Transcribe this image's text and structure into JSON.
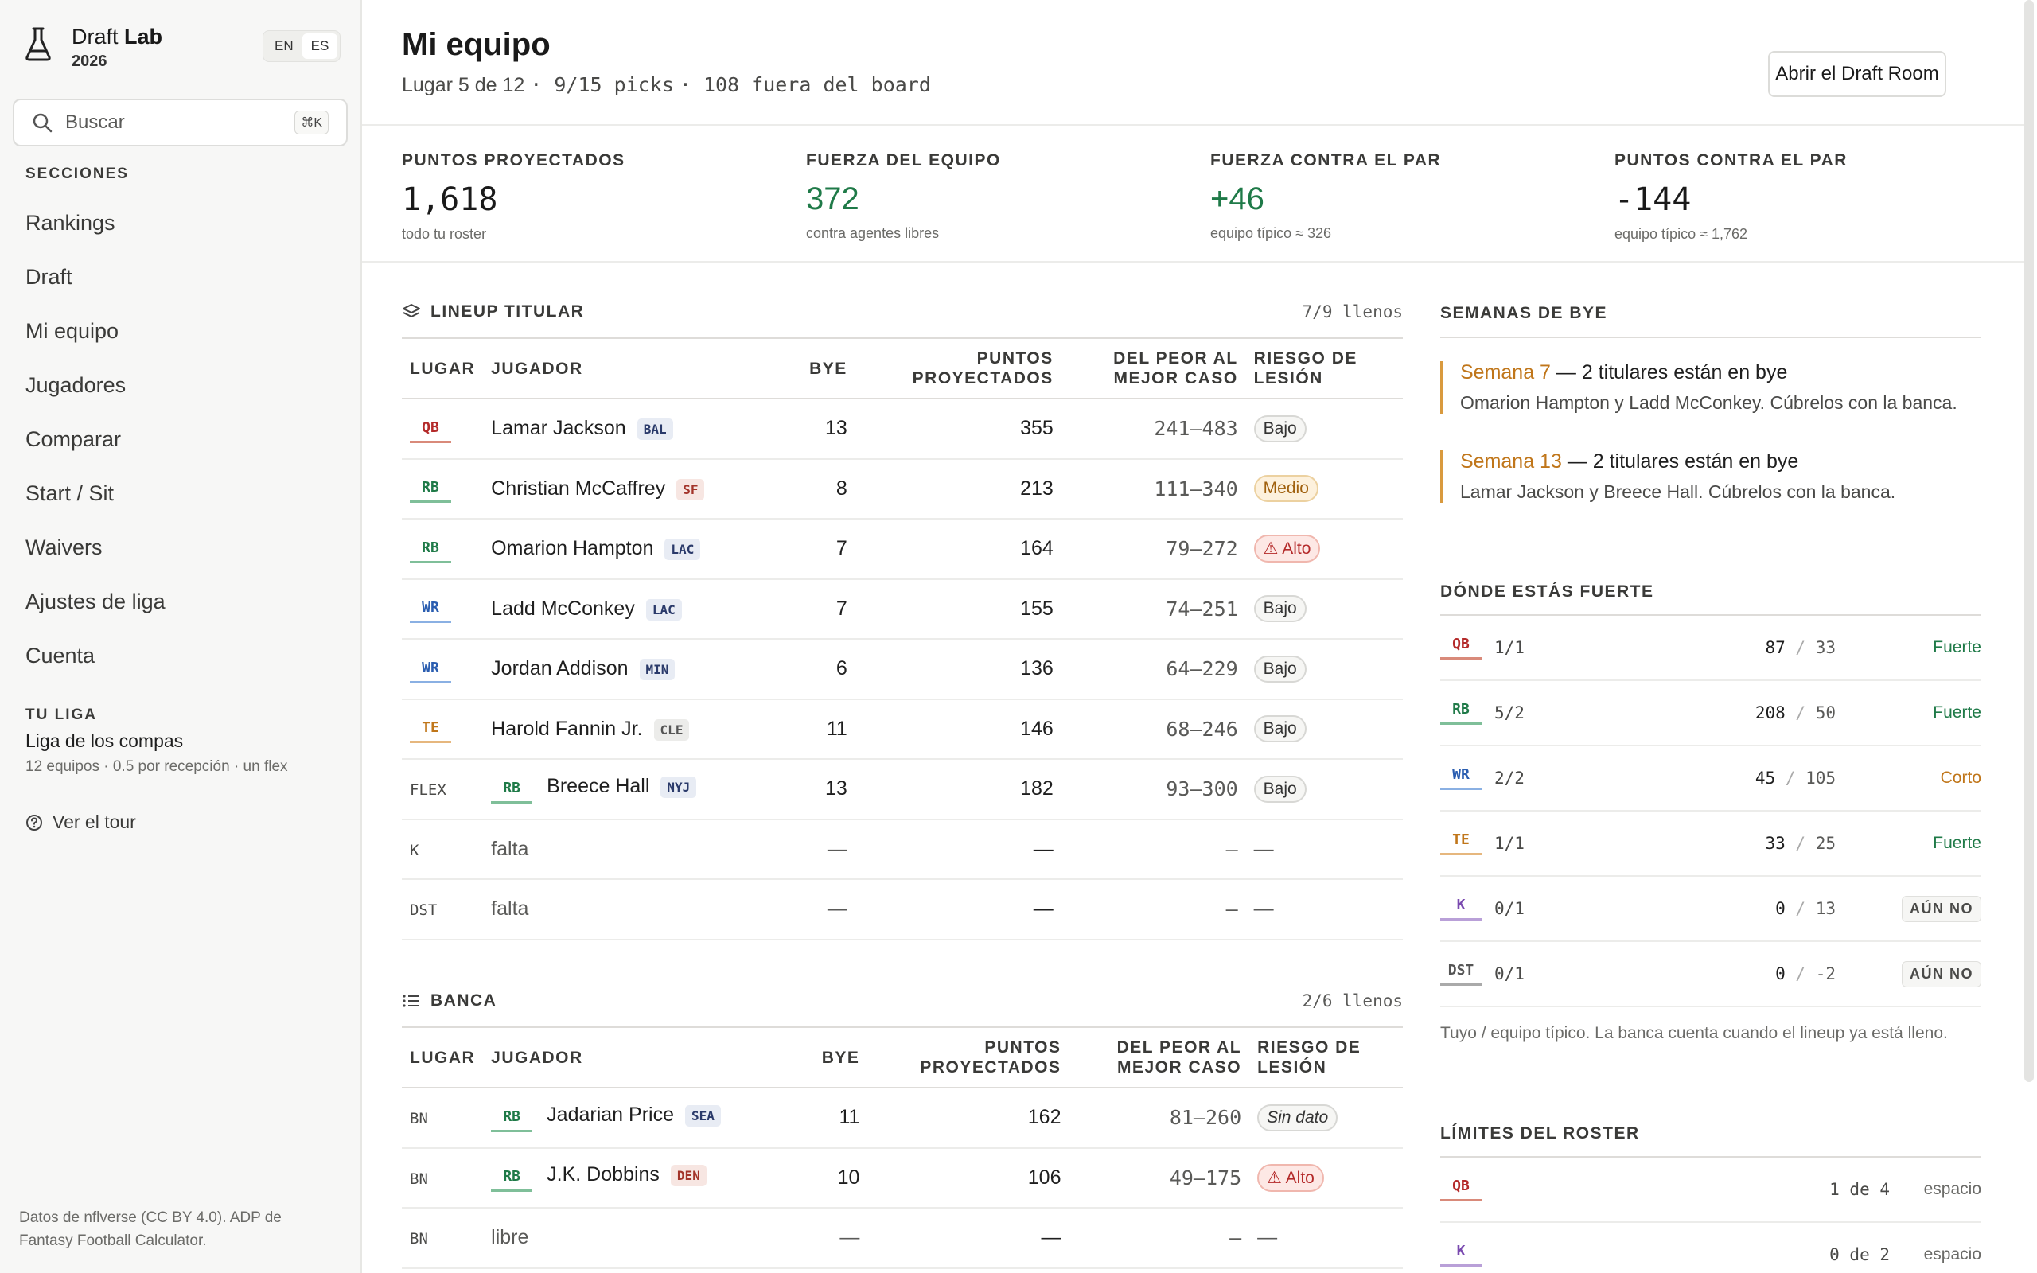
{
  "app": {
    "name_plain": "Draft",
    "name_bold": "Lab",
    "year": "2026",
    "lang_en": "EN",
    "lang_es": "ES"
  },
  "search": {
    "placeholder": "Buscar",
    "shortcut": "⌘K"
  },
  "sidebar": {
    "sections_heading": "SECCIONES",
    "items": [
      {
        "label": "Rankings"
      },
      {
        "label": "Draft"
      },
      {
        "label": "Mi equipo"
      },
      {
        "label": "Jugadores"
      },
      {
        "label": "Comparar"
      },
      {
        "label": "Start / Sit"
      },
      {
        "label": "Waivers"
      },
      {
        "label": "Ajustes de liga"
      },
      {
        "label": "Cuenta"
      }
    ],
    "league_heading": "TU LIGA",
    "league_name": "Liga de los compas",
    "league_desc": "12 equipos · 0.5 por recepción · un flex",
    "tour_label": "Ver el tour",
    "footer": "Datos de nflverse (CC BY 4.0). ADP de Fantasy Football Calculator."
  },
  "header": {
    "title": "Mi equipo",
    "subtitle_place": "Lugar 5 de 12",
    "subtitle_picks": "9/15 picks",
    "subtitle_off": "108 fuera del board",
    "open_room": "Abrir el Draft Room"
  },
  "stats": [
    {
      "label": "PUNTOS PROYECTADOS",
      "value": "1,618",
      "sub": "todo tu roster"
    },
    {
      "label": "FUERZA DEL EQUIPO",
      "value": "372",
      "sub": "contra agentes libres"
    },
    {
      "label": "FUERZA CONTRA EL PAR",
      "value": "+46",
      "sub": "equipo típico ≈ 326"
    },
    {
      "label": "PUNTOS CONTRA EL PAR",
      "value": "-144",
      "sub": "equipo típico ≈ 1,762"
    }
  ],
  "columns": {
    "slot": "LUGAR",
    "player": "JUGADOR",
    "bye": "BYE",
    "proj1": "PUNTOS",
    "proj2": "PROYECTADOS",
    "range1": "DEL PEOR AL",
    "range2": "MEJOR CASO",
    "risk1": "RIESGO DE",
    "risk2": "LESIÓN"
  },
  "lineup": {
    "title": "LINEUP TITULAR",
    "count": "7/9 llenos",
    "rows": [
      {
        "slot": "QB",
        "pos": "QB",
        "player": "Lamar Jackson",
        "team": "BAL",
        "bye": "13",
        "proj": "355",
        "range": "241–483",
        "risk": "Bajo"
      },
      {
        "slot": "RB",
        "pos": "RB",
        "player": "Christian McCaffrey",
        "team": "SF",
        "bye": "8",
        "proj": "213",
        "range": "111–340",
        "risk": "Medio"
      },
      {
        "slot": "RB",
        "pos": "RB",
        "player": "Omarion Hampton",
        "team": "LAC",
        "bye": "7",
        "proj": "164",
        "range": "79–272",
        "risk": "Alto"
      },
      {
        "slot": "WR",
        "pos": "WR",
        "player": "Ladd McConkey",
        "team": "LAC",
        "bye": "7",
        "proj": "155",
        "range": "74–251",
        "risk": "Bajo"
      },
      {
        "slot": "WR",
        "pos": "WR",
        "player": "Jordan Addison",
        "team": "MIN",
        "bye": "6",
        "proj": "136",
        "range": "64–229",
        "risk": "Bajo"
      },
      {
        "slot": "TE",
        "pos": "TE",
        "player": "Harold Fannin Jr.",
        "team": "CLE",
        "bye": "11",
        "proj": "146",
        "range": "68–246",
        "risk": "Bajo"
      },
      {
        "slot": "FLEX",
        "pos": "RB",
        "player": "Breece Hall",
        "team": "NYJ",
        "bye": "13",
        "proj": "182",
        "range": "93–300",
        "risk": "Bajo"
      },
      {
        "slot": "K",
        "player": "falta",
        "bye": "—",
        "proj": "—",
        "range": "—",
        "risk": "—"
      },
      {
        "slot": "DST",
        "player": "falta",
        "bye": "—",
        "proj": "—",
        "range": "—",
        "risk": "—"
      }
    ]
  },
  "bench": {
    "title": "BANCA",
    "count": "2/6 llenos",
    "rows": [
      {
        "slot": "BN",
        "pos": "RB",
        "player": "Jadarian Price",
        "team": "SEA",
        "bye": "11",
        "proj": "162",
        "range": "81–260",
        "risk": "Sin dato"
      },
      {
        "slot": "BN",
        "pos": "RB",
        "player": "J.K. Dobbins",
        "team": "DEN",
        "bye": "10",
        "proj": "106",
        "range": "49–175",
        "risk": "Alto"
      },
      {
        "slot": "BN",
        "player": "libre",
        "bye": "—",
        "proj": "—",
        "range": "—",
        "risk": "—"
      }
    ]
  },
  "bye_weeks": {
    "title": "SEMANAS DE BYE",
    "cards": [
      {
        "week": "Semana 7",
        "headline": " — 2 titulares están en bye",
        "text": "Omarion Hampton y Ladd McConkey. Cúbrelos con la banca."
      },
      {
        "week": "Semana 13",
        "headline": " — 2 titulares están en bye",
        "text": "Lamar Jackson y Breece Hall. Cúbrelos con la banca."
      }
    ]
  },
  "strengths": {
    "title": "DÓNDE ESTÁS FUERTE",
    "rows": [
      {
        "pos": "QB",
        "frac": "1/1",
        "yours": "87",
        "typical": "33",
        "tag": "Fuerte"
      },
      {
        "pos": "RB",
        "frac": "5/2",
        "yours": "208",
        "typical": "50",
        "tag": "Fuerte"
      },
      {
        "pos": "WR",
        "frac": "2/2",
        "yours": "45",
        "typical": "105",
        "tag": "Corto"
      },
      {
        "pos": "TE",
        "frac": "1/1",
        "yours": "33",
        "typical": "25",
        "tag": "Fuerte"
      },
      {
        "pos": "K",
        "frac": "0/1",
        "yours": "0",
        "typical": "13",
        "tag": "AÚN NO"
      },
      {
        "pos": "DST",
        "frac": "0/1",
        "yours": "0",
        "typical": "-2",
        "tag": "AÚN NO"
      }
    ],
    "note": "Tuyo / equipo típico. La banca cuenta cuando el lineup ya está lleno."
  },
  "limits": {
    "title": "LÍMITES DEL ROSTER",
    "rows": [
      {
        "pos": "QB",
        "value": "1 de 4",
        "label": "espacio"
      },
      {
        "pos": "K",
        "value": "0 de 2",
        "label": "espacio"
      }
    ]
  },
  "colors": {
    "accent_green": "#1f7a48",
    "bye_orange": "#c0761a",
    "risk_high": "#b42a2a"
  },
  "icons": [
    "flask-icon",
    "search-icon",
    "help-circle-icon",
    "layers-icon",
    "list-icon",
    "warning-icon"
  ]
}
